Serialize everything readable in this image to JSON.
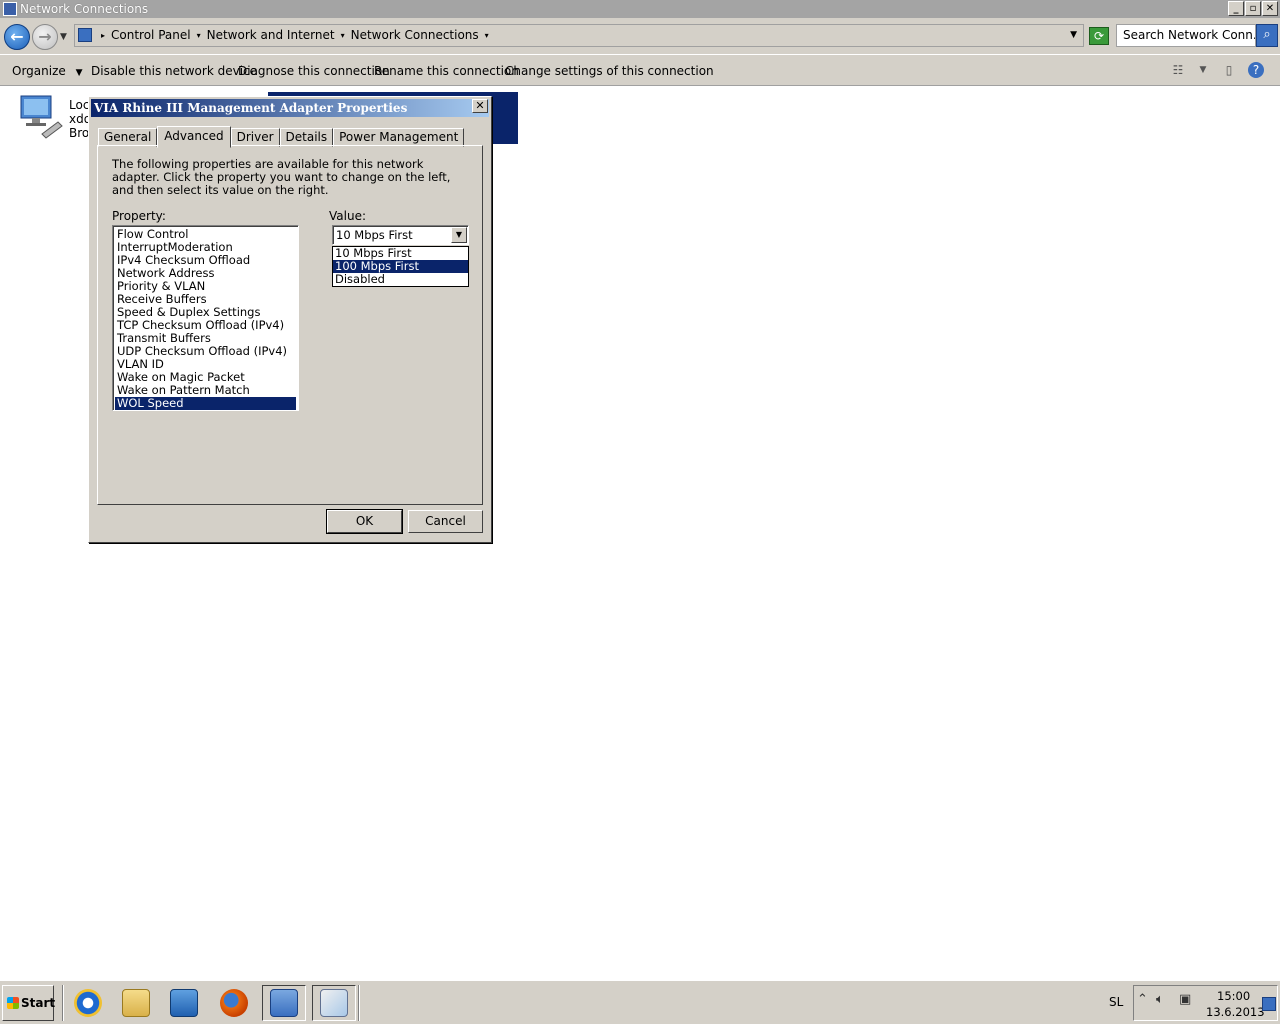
{
  "window": {
    "title": "Network Connections",
    "controls": {
      "minimize": "_",
      "maximize": "▫",
      "close": "✕"
    }
  },
  "address": {
    "breadcrumbs": [
      "Control Panel",
      "Network and Internet",
      "Network Connections"
    ],
    "search_placeholder": "Search Network Conn..."
  },
  "commands": {
    "organize": "Organize",
    "disable": "Disable this network device",
    "diagnose": "Diagnose this connection",
    "rename": "Rename this connection",
    "change_settings": "Change settings of this connection"
  },
  "connection": {
    "line1": "Loca",
    "line2": "xdo",
    "line3": "Broa"
  },
  "dialog": {
    "title": "VIA Rhine III Management Adapter Properties",
    "close": "✕",
    "tabs": [
      "General",
      "Advanced",
      "Driver",
      "Details",
      "Power Management"
    ],
    "active_tab": "Advanced",
    "description": "The following properties are available for this network adapter. Click the property you want to change on the left, and then select its value on the right.",
    "property_label": "Property:",
    "value_label": "Value:",
    "properties": [
      "Flow Control",
      "InterruptModeration",
      "IPv4 Checksum Offload",
      "Network Address",
      "Priority & VLAN",
      "Receive Buffers",
      "Speed & Duplex Settings",
      "TCP Checksum Offload (IPv4)",
      "Transmit Buffers",
      "UDP Checksum Offload (IPv4)",
      "VLAN ID",
      "Wake on Magic Packet",
      "Wake on Pattern Match",
      "WOL Speed"
    ],
    "selected_property": "WOL Speed",
    "value_selected": "10 Mbps First",
    "value_options": [
      "10 Mbps First",
      "100 Mbps First",
      "Disabled"
    ],
    "highlighted_option": "100 Mbps First",
    "ok": "OK",
    "cancel": "Cancel"
  },
  "taskbar": {
    "start": "Start",
    "language": "SL",
    "time": "15:00",
    "date": "13.6.2013"
  },
  "colors": {
    "selection": "#0a246a",
    "face": "#d4d0c8"
  }
}
